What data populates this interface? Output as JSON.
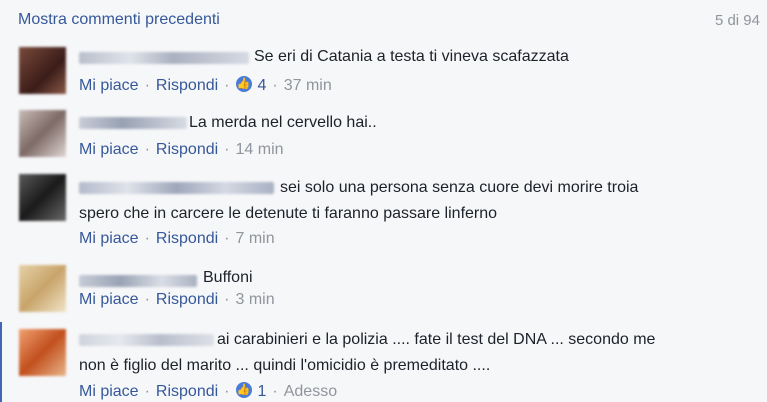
{
  "header": {
    "show_previous": "Mostra commenti precedenti",
    "count": "5 di 94"
  },
  "actions": {
    "like": "Mi piace",
    "reply": "Rispondi",
    "separator": "·"
  },
  "comments": [
    {
      "text1": "Se eri di Catania a testa ti vineva scafazzata",
      "text2": "",
      "likes": "4",
      "time": "37 min"
    },
    {
      "text1": "La merda nel cervello hai..",
      "text2": "",
      "likes": "",
      "time": "14 min"
    },
    {
      "text1": "sei solo una persona senza cuore devi morire troia",
      "text2": "spero che in carcere le detenute ti faranno passare linferno",
      "likes": "",
      "time": "7 min"
    },
    {
      "text1": "Buffoni",
      "text2": "",
      "likes": "",
      "time": "3 min"
    },
    {
      "text1": "ai carabinieri e la polizia .... fate il test del DNA ... secondo me",
      "text2": "non è figlio del marito ... quindi l'omicidio è premeditato ....",
      "likes": "1",
      "time": "Adesso"
    }
  ],
  "icons": {
    "like_badge": "thumbs-up-icon"
  },
  "colors": {
    "link": "#365899",
    "meta": "#90949c",
    "like_badge": "#4a7bd8",
    "background": "#f6f7f9"
  }
}
